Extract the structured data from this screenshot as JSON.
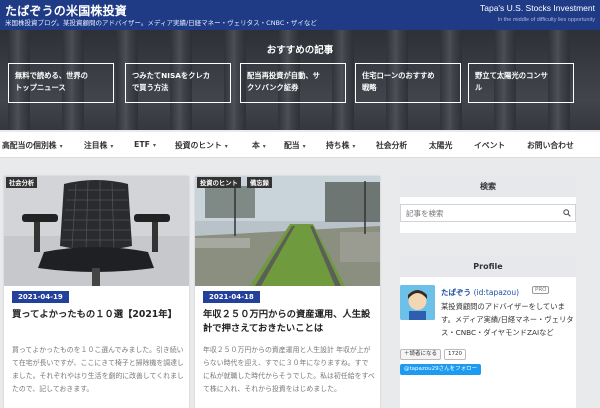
{
  "header": {
    "site_title": "たぱぞうの米国株投資",
    "site_description": "米国株投資ブログ。某投資顧問のアドバイザー。メディア実績/日経マネー・ヴェリタス・CNBC・ザイなど",
    "right_title": "Tapa's U.S. Stocks Investment",
    "right_subtitle": "In the middle of difficulty lies opportunity"
  },
  "hero": {
    "title": "おすすめの記事",
    "recommended": [
      {
        "line1": "無料で読める、世界の",
        "line2": "トップニュース"
      },
      {
        "line1": "つみたてNISAをクレカ",
        "line2": "で買う方法"
      },
      {
        "line1": "配当再投資が自動、サ",
        "line2": "クソバンク証券"
      },
      {
        "line1": "住宅ローンのおすすめ",
        "line2": "戦略"
      },
      {
        "line1": "野立て太陽光のコンサ",
        "line2": "ル"
      }
    ]
  },
  "nav": {
    "items": [
      {
        "label": "高配当の個別株",
        "caret": "▾"
      },
      {
        "label": "注目株",
        "caret": "▾"
      },
      {
        "label": "ETF",
        "caret": "▾"
      },
      {
        "label": "投資のヒント",
        "caret": "▾"
      },
      {
        "label": "本",
        "caret": "▾"
      },
      {
        "label": "配当",
        "caret": "▾"
      },
      {
        "label": "持ち株",
        "caret": "▾"
      },
      {
        "label": "社会分析",
        "caret": ""
      },
      {
        "label": "太陽光",
        "caret": ""
      },
      {
        "label": "イベント",
        "caret": ""
      },
      {
        "label": "お問い合わせ",
        "caret": ""
      }
    ]
  },
  "posts": [
    {
      "categories": [
        "社会分析"
      ],
      "date": "2021-04-19",
      "title": "買ってよかったもの１０選【2021年】",
      "excerpt": "買ってよかったものを１０こ選んでみました。引き続いて在宅が長いですが、ここにきて椅子と掃除機を調達しました。それぞれやはり生活を劇的に改善してくれましたので、記しておきます。"
    },
    {
      "categories": [
        "投資のヒント",
        "備忘録"
      ],
      "date": "2021-04-18",
      "title": "年収２５０万円からの資産運用、人生設計で押さえておきたいことは",
      "excerpt": "年収２５０万円からの資産運用と人生設計 年収が上がらない時代を迎え、すでに３０年になりますね。すでに私が就職した時代からそうでした。私は初任給をすべて株に入れ、それから投資をはじめました。"
    }
  ],
  "sidebar": {
    "search_heading": "検索",
    "search_placeholder": "記事を検索",
    "profile_heading": "Profile",
    "profile_name": "たぱぞう",
    "profile_id": "(id:tapazou)",
    "pro_badge": "PRO",
    "profile_desc": "某投資顧問のアドバイザーをしています。メディア実績/日経マネー・ヴェリタス・CNBC・ダイヤモンドZAIなど",
    "reader_button": "＋読者になる",
    "reader_count": "1720",
    "twitter_button": "@tapazou29さんをフォロー"
  }
}
